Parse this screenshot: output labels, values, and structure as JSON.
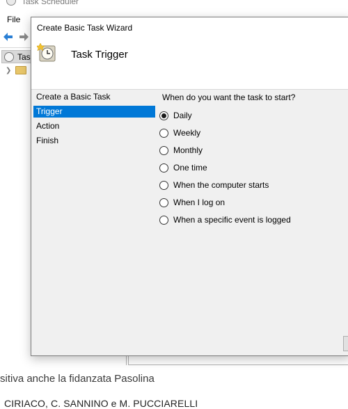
{
  "background_app": {
    "title": "Task Scheduler",
    "menu": [
      "File"
    ],
    "tree": [
      {
        "label": "Tas",
        "icon": "task-scheduler-icon"
      },
      {
        "label": "",
        "icon": "folder-clock-icon"
      }
    ]
  },
  "document_text": {
    "line1": "sitiva anche la fidanzata Pasolina",
    "line2": "CIRIACO, C. SANNINO e M. PUCCIARELLI"
  },
  "dialog": {
    "title": "Create Basic Task Wizard",
    "header_title": "Task Trigger",
    "steps": [
      {
        "label": "Create a Basic Task",
        "active": false
      },
      {
        "label": "Trigger",
        "active": true
      },
      {
        "label": "Action",
        "active": false
      },
      {
        "label": "Finish",
        "active": false
      }
    ],
    "question": "When do you want the task to start?",
    "options": [
      {
        "label": "Daily",
        "checked": true
      },
      {
        "label": "Weekly",
        "checked": false
      },
      {
        "label": "Monthly",
        "checked": false
      },
      {
        "label": "One time",
        "checked": false
      },
      {
        "label": "When the computer starts",
        "checked": false
      },
      {
        "label": "When I log on",
        "checked": false
      },
      {
        "label": "When a specific event is logged",
        "checked": false
      }
    ],
    "accent_color": "#0078d7"
  }
}
